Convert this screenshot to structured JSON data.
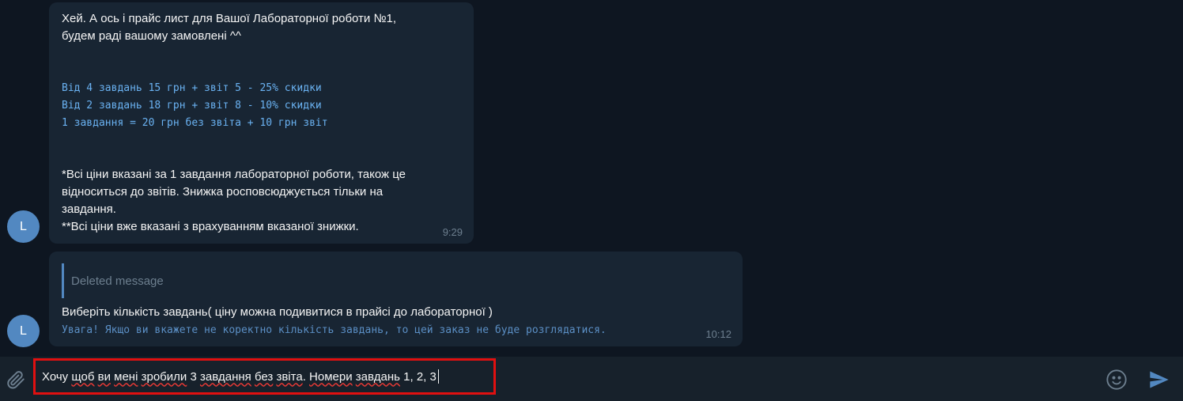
{
  "theme": {
    "chat_bg": "#0e1621",
    "bubble_bg": "#182533",
    "accent": "#5288c1",
    "code_color": "#6ab2f2",
    "highlight_border": "#e01010"
  },
  "messages": [
    {
      "avatar_letter": "L",
      "intro": "Хей. А ось і прайс лист для Вашої Лабораторної роботи №1,\nбудем раді вашому замовлені ^^",
      "price_lines": [
        "Від 4 завдань 15 грн + звіт 5 - 25% скидки",
        "Від 2 завдань 18 грн + звіт 8 - 10% скидки",
        "1 завдання = 20 грн без звіта + 10 грн звіт"
      ],
      "notes": "*Всі ціни вказані за 1 завдання лабораторної роботи, також це\nвідноситься до звітів. Знижка росповсюджується тільки на\nзавдання.\n**Всі ціни вже вказані з врахуванням вказаної знижки.",
      "time": "9:29"
    },
    {
      "avatar_letter": "L",
      "reply_preview": "Deleted message",
      "text": "Виберіть кількість завдань( ціну можна подивитися в прайсі до лабораторної )",
      "warning": "Увага! Якщо ви вкажете не коректно кількість завдань, то цей заказ не буде розглядатися.",
      "time": "10:12"
    }
  ],
  "composer": {
    "attach_icon": "paperclip-icon",
    "emoji_icon": "emoji-icon",
    "send_icon": "send-icon",
    "input_parts": [
      {
        "text": "Хочу ",
        "misspelled": false
      },
      {
        "text": "щоб",
        "misspelled": true
      },
      {
        "text": " ",
        "misspelled": false
      },
      {
        "text": "ви",
        "misspelled": true
      },
      {
        "text": " ",
        "misspelled": false
      },
      {
        "text": "мені",
        "misspelled": true
      },
      {
        "text": " ",
        "misspelled": false
      },
      {
        "text": "зробили",
        "misspelled": true
      },
      {
        "text": " 3 ",
        "misspelled": false
      },
      {
        "text": "завдання",
        "misspelled": true
      },
      {
        "text": " ",
        "misspelled": false
      },
      {
        "text": "без",
        "misspelled": true
      },
      {
        "text": " ",
        "misspelled": false
      },
      {
        "text": "звіта",
        "misspelled": true
      },
      {
        "text": ". ",
        "misspelled": false
      },
      {
        "text": "Номери",
        "misspelled": true
      },
      {
        "text": " ",
        "misspelled": false
      },
      {
        "text": "завдань",
        "misspelled": true
      },
      {
        "text": " 1, 2, 3",
        "misspelled": false
      }
    ]
  }
}
